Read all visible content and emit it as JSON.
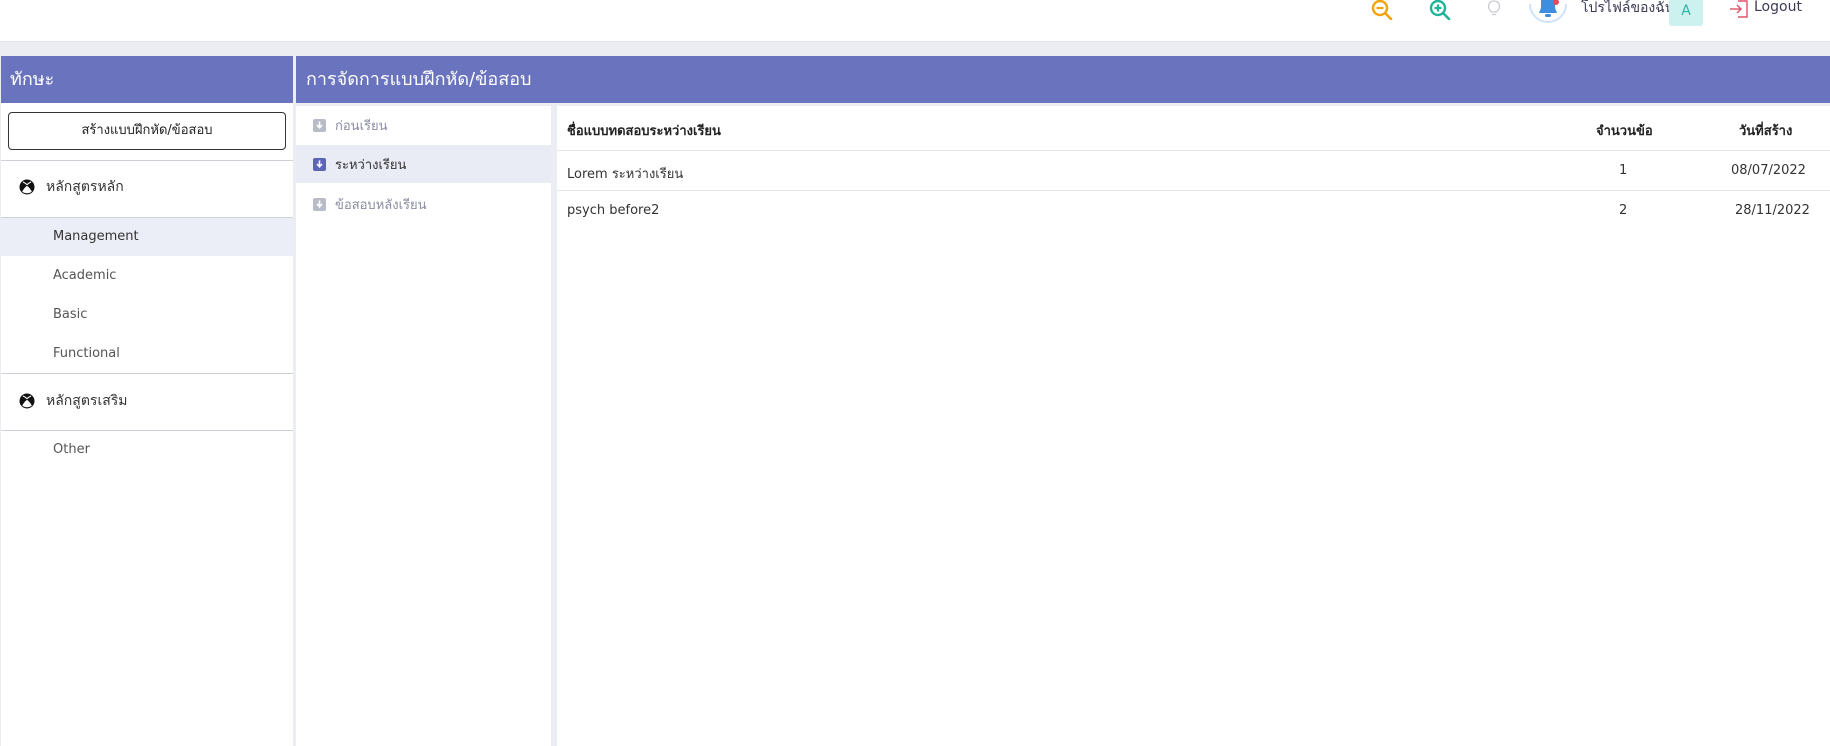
{
  "topbar": {
    "profile_label": "โปรไฟล์ของฉัน",
    "avatar_initial": "A",
    "logout_label": "Logout",
    "colors": {
      "zoom_out": "#f0a30a",
      "zoom_in": "#1fb39a",
      "bell": "#3d8de0",
      "avatar_bg": "#cdf1ee",
      "logout": "#e0506a"
    }
  },
  "sidebar": {
    "title": "ทักษะ",
    "create_button": "สร้างแบบฝึกหัด/ข้อสอบ",
    "groups": [
      {
        "label": "หลักสูตรหลัก",
        "items": [
          "Management",
          "Academic",
          "Basic",
          "Functional"
        ]
      },
      {
        "label": "หลักสูตรเสริม",
        "items": [
          "Other"
        ]
      }
    ],
    "active_item": "Management"
  },
  "main": {
    "title": "การจัดการแบบฝึกหัด/ข้อสอบ",
    "tabs": [
      {
        "label": "ก่อนเรียน"
      },
      {
        "label": "ระหว่างเรียน"
      },
      {
        "label": "ข้อสอบหลังเรียน"
      }
    ],
    "active_tab": "ระหว่างเรียน",
    "table": {
      "headers": {
        "name": "ชื่อแบบทดสอบระหว่างเรียน",
        "count": "จำนวนข้อ",
        "date": "วันที่สร้าง"
      },
      "rows": [
        {
          "name": "Lorem ระหว่างเรียน",
          "count": "1",
          "date": "08/07/2022"
        },
        {
          "name": "psych before2",
          "count": "2",
          "date": "28/11/2022"
        }
      ]
    }
  },
  "theme": {
    "header_bg": "#6a73bd",
    "active_bg": "#eceef7",
    "page_bg": "#ebedf3"
  }
}
